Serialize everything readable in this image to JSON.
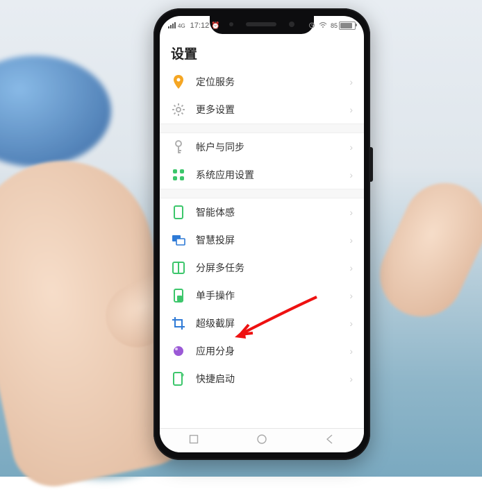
{
  "status": {
    "signal_label": "4G",
    "time": "17:12",
    "battery_pct": "85"
  },
  "title": "设置",
  "groups": [
    {
      "items": [
        {
          "key": "location",
          "icon": "location-icon",
          "color": "#f5a623",
          "label": "定位服务"
        },
        {
          "key": "more",
          "icon": "gear-icon",
          "color": "#b0b0b0",
          "label": "更多设置"
        }
      ]
    },
    {
      "items": [
        {
          "key": "account",
          "icon": "key-icon",
          "color": "#b0b0b0",
          "label": "帐户与同步"
        },
        {
          "key": "sysapps",
          "icon": "grid-icon",
          "color": "#3cc66b",
          "label": "系统应用设置"
        }
      ]
    },
    {
      "items": [
        {
          "key": "motion",
          "icon": "phone-icon",
          "color": "#3cc66b",
          "label": "智能体感"
        },
        {
          "key": "cast",
          "icon": "cast-icon",
          "color": "#2e7ad6",
          "label": "智慧投屏"
        },
        {
          "key": "split",
          "icon": "split-icon",
          "color": "#3cc66b",
          "label": "分屏多任务"
        },
        {
          "key": "onehand",
          "icon": "onehand-icon",
          "color": "#3cc66b",
          "label": "单手操作"
        },
        {
          "key": "sshot",
          "icon": "crop-icon",
          "color": "#2e7ad6",
          "label": "超级截屏"
        },
        {
          "key": "appclone",
          "icon": "circle-icon",
          "color": "#9b59d6",
          "label": "应用分身"
        },
        {
          "key": "quick",
          "icon": "launch-icon",
          "color": "#3cc66b",
          "label": "快捷启动"
        }
      ]
    }
  ],
  "annotation": {
    "target_key": "sshot"
  }
}
